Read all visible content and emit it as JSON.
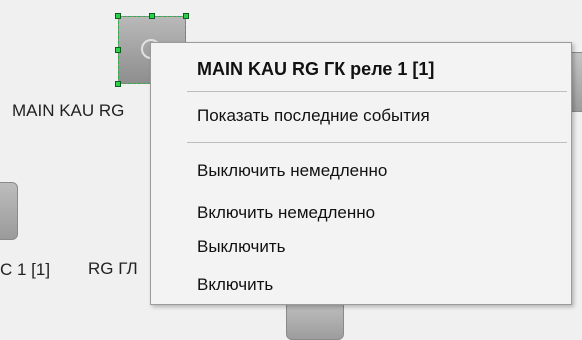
{
  "canvas": {
    "labels": {
      "main_device": "MAIN KAU RG",
      "left_device": "С 1 [1]",
      "rg_device": "RG ГЛ"
    }
  },
  "context_menu": {
    "title": "MAIN KAU RG ГК реле 1 [1]",
    "items": [
      "Показать последние события",
      "Выключить немедленно",
      "Включить немедленно",
      "Выключить",
      "Включить"
    ]
  },
  "colors": {
    "background": "#f0f0f0",
    "menu_background": "#f3f3f3",
    "selection_handle": "#2bd14d",
    "device_tile": "#a9a9a9"
  }
}
